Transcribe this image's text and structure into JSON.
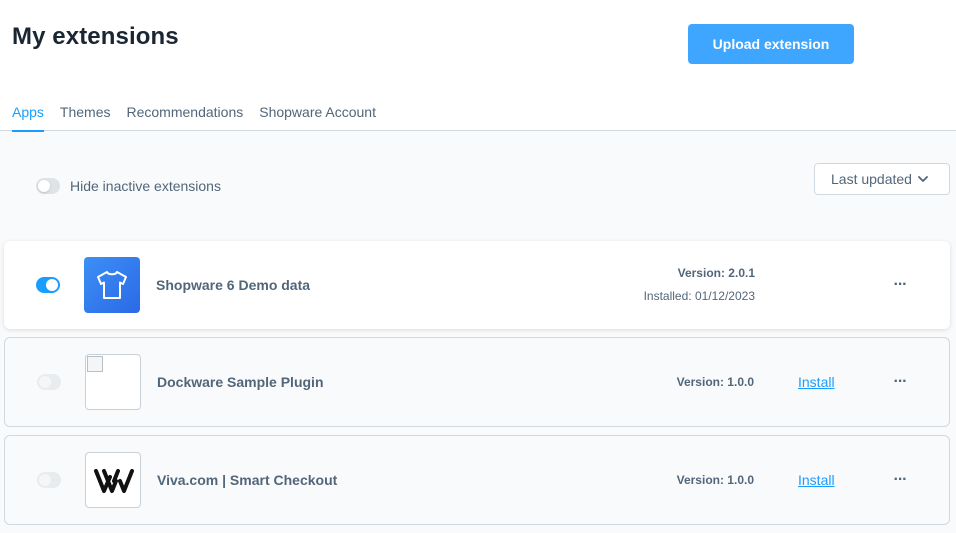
{
  "header": {
    "title": "My extensions",
    "upload_label": "Upload extension"
  },
  "tabs": [
    {
      "label": "Apps",
      "active": true
    },
    {
      "label": "Themes",
      "active": false
    },
    {
      "label": "Recommendations",
      "active": false
    },
    {
      "label": "Shopware Account",
      "active": false
    }
  ],
  "filters": {
    "hide_inactive_label": "Hide inactive extensions",
    "hide_inactive_on": false,
    "sort_label": "Last updated",
    "sort_icon": "chevron-down-icon"
  },
  "extensions": [
    {
      "name": "Shopware 6 Demo data",
      "version": "Version: 2.0.1",
      "installed": "Installed: 01/12/2023",
      "active": true,
      "icon": "tshirt-icon",
      "menu": "···"
    },
    {
      "name": "Dockware Sample Plugin",
      "version": "Version: 1.0.0",
      "install_label": "Install",
      "active": false,
      "icon": "broken-image-icon",
      "menu": "···"
    },
    {
      "name": "Viva.com | Smart Checkout",
      "version": "Version: 1.0.0",
      "install_label": "Install",
      "active": false,
      "icon": "viva-logo-icon",
      "menu": "···"
    }
  ],
  "colors": {
    "accent": "#189eff",
    "button": "#3fa6ff",
    "text": "#52667a",
    "title": "#1b2633"
  }
}
